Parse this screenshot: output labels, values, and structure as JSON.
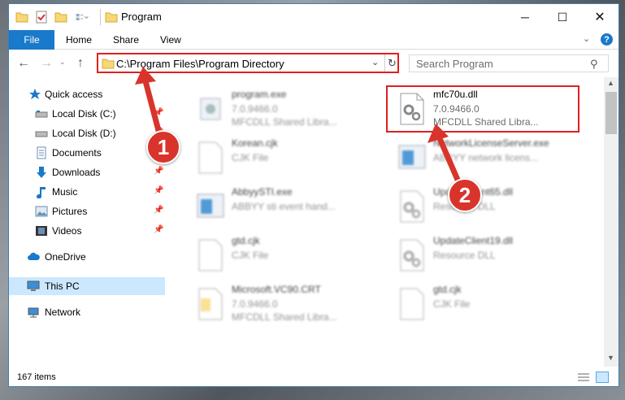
{
  "window": {
    "title": "Program",
    "controls": {
      "minimize": "─",
      "maximize": "☐",
      "close": "✕"
    }
  },
  "ribbon": {
    "tabs": [
      "File",
      "Home",
      "Share",
      "View"
    ],
    "expand_glyph": "⌄",
    "help_glyph": "?"
  },
  "address": {
    "path": "C:\\Program Files\\Program Directory",
    "dropdown_glyph": "⌄",
    "refresh_glyph": "↻"
  },
  "navigation": {
    "back": "←",
    "forward": "→",
    "recent": "⌄",
    "up": "↑"
  },
  "search": {
    "placeholder": "Search Program",
    "icon_glyph": "⚲"
  },
  "sidebar": {
    "pin_glyph": "📌",
    "items": [
      {
        "label": "Quick access",
        "icon": "star-icon",
        "pinned": false
      },
      {
        "label": "Local Disk (C:)",
        "icon": "drive-icon",
        "pinned": true
      },
      {
        "label": "Local Disk (D:)",
        "icon": "drive-icon",
        "pinned": true
      },
      {
        "label": "Documents",
        "icon": "documents-icon",
        "pinned": true
      },
      {
        "label": "Downloads",
        "icon": "download-icon",
        "pinned": true
      },
      {
        "label": "Music",
        "icon": "music-icon",
        "pinned": true
      },
      {
        "label": "Pictures",
        "icon": "pictures-icon",
        "pinned": true
      },
      {
        "label": "Videos",
        "icon": "videos-icon",
        "pinned": true
      },
      {
        "label": "OneDrive",
        "icon": "cloud-icon",
        "pinned": false
      },
      {
        "label": "This PC",
        "icon": "computer-icon",
        "pinned": false,
        "selected": true
      },
      {
        "label": "Network",
        "icon": "network-icon",
        "pinned": false
      }
    ]
  },
  "files": [
    {
      "name": "program.exe",
      "line2": "7.0.9466.0",
      "line3": "MFCDLL Shared Libra...",
      "icon": "exe-icon",
      "highlighted": false
    },
    {
      "name": "mfc70u.dll",
      "line2": "7.0.9466.0",
      "line3": "MFCDLL Shared Libra...",
      "icon": "dll-icon",
      "highlighted": true
    },
    {
      "name": "Korean.cjk",
      "line2": "CJK File",
      "line3": "",
      "icon": "blank-file-icon",
      "highlighted": false
    },
    {
      "name": "NetworkLicenseServer.exe",
      "line2": "ABBYY network licens...",
      "line3": "",
      "icon": "exe-window-icon",
      "highlighted": false
    },
    {
      "name": "AbbyySTI.exe",
      "line2": "ABBYY sti event hand...",
      "line3": "",
      "icon": "exe-window-icon",
      "highlighted": false
    },
    {
      "name": "UpdateClient65.dll",
      "line2": "Resource DLL",
      "line3": "",
      "icon": "dll-icon",
      "highlighted": false
    },
    {
      "name": "gtd.cjk",
      "line2": "CJK File",
      "line3": "",
      "icon": "blank-file-icon",
      "highlighted": false
    },
    {
      "name": "UpdateClient19.dll",
      "line2": "Resource DLL",
      "line3": "",
      "icon": "dll-icon",
      "highlighted": false
    },
    {
      "name": "Microsoft.VC90.CRT",
      "line2": "7.0.9466.0",
      "line3": "MFCDLL Shared Libra...",
      "icon": "folder-file-icon",
      "highlighted": false
    },
    {
      "name": "gtd.cjk",
      "line2": "CJK File",
      "line3": "",
      "icon": "blank-file-icon",
      "highlighted": false
    }
  ],
  "status": {
    "item_count": "167 items"
  },
  "annotations": {
    "step1": "1",
    "step2": "2"
  },
  "colors": {
    "accent": "#1979ca",
    "highlight": "#e02020",
    "callout": "#d9342b",
    "selection": "#cce8ff"
  }
}
